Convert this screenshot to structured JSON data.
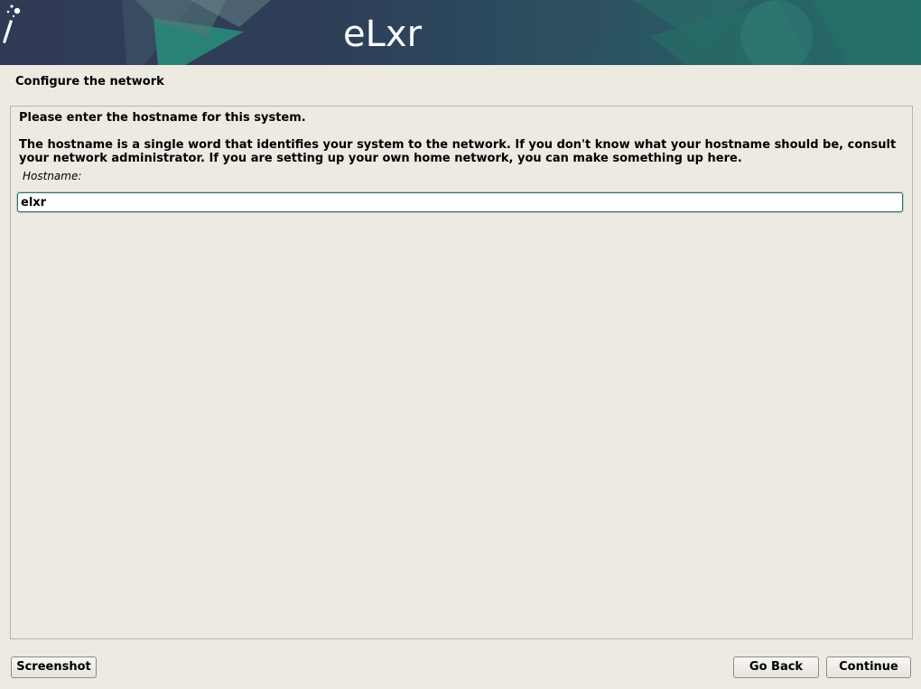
{
  "banner": {
    "logo_text": "eLxr"
  },
  "page": {
    "title": "Configure the network"
  },
  "question": {
    "prompt": "Please enter the hostname for this system.",
    "description": "The hostname is a single word that identifies your system to the network. If you don't know what your hostname should be, consult your network administrator. If you are setting up your own home network, you can make something up here.",
    "field_label": "Hostname:",
    "field_value": "elxr"
  },
  "buttons": {
    "screenshot": "Screenshot",
    "go_back": "Go Back",
    "continue": "Continue"
  },
  "colors": {
    "banner_dark": "#2f3d57",
    "banner_teal": "#2b7a73",
    "background": "#edeae2",
    "input_border": "#2f6e66"
  }
}
